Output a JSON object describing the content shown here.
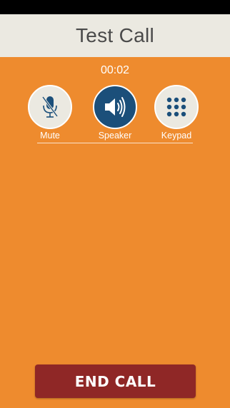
{
  "header": {
    "title": "Test Call"
  },
  "call": {
    "timer": "00:02"
  },
  "controls": {
    "mute": {
      "label": "Mute",
      "icon": "microphone-muted-icon",
      "active": false
    },
    "speaker": {
      "label": "Speaker",
      "icon": "speaker-icon",
      "active": true
    },
    "keypad": {
      "label": "Keypad",
      "icon": "keypad-icon",
      "active": false
    }
  },
  "end_call": {
    "label": "END CALL"
  },
  "colors": {
    "background": "#ee8b2e",
    "title_bar": "#ebe9e1",
    "active_button": "#1b4f7a",
    "icon": "#1b4f7a",
    "end_call": "#8f2726"
  }
}
